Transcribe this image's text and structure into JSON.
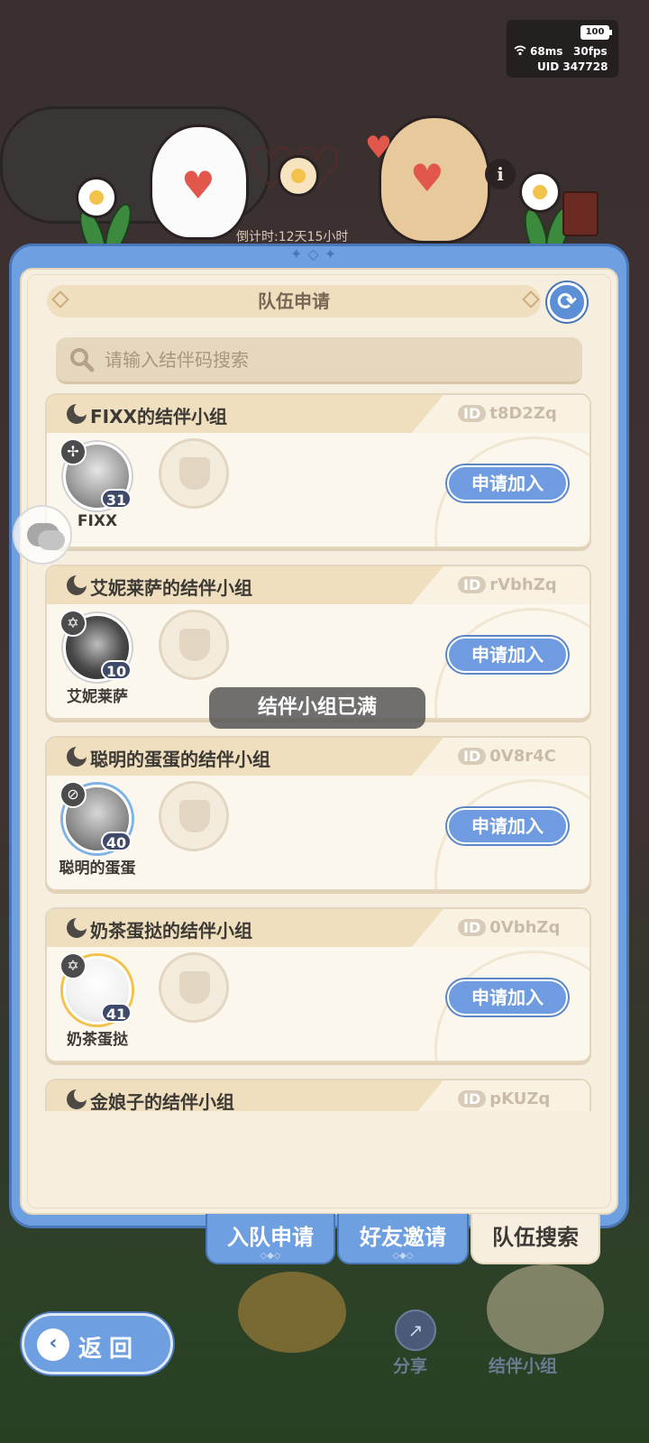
{
  "status": {
    "battery": "100",
    "ping": "68ms",
    "fps": "30fps",
    "uid": "UID 347728"
  },
  "header": {
    "countdown": "倒计时:12天15小时",
    "info_icon": "i"
  },
  "panel": {
    "title": "队伍申请",
    "refresh_icon": "⟳",
    "search_placeholder": "请输入结伴码搜索"
  },
  "groups": [
    {
      "title": "FIXX的结伴小组",
      "id_label": "ID",
      "id": "t8D2Zq",
      "member": "FIXX",
      "level": "31",
      "element": "✢",
      "join": "申请加入"
    },
    {
      "title": "艾妮莱萨的结伴小组",
      "id_label": "ID",
      "id": "rVbhZq",
      "member": "艾妮莱萨",
      "level": "10",
      "element": "✡",
      "join": "申请加入"
    },
    {
      "title": "聪明的蛋蛋的结伴小组",
      "id_label": "ID",
      "id": "0V8r4C",
      "member": "聪明的蛋蛋",
      "level": "40",
      "element": "⊘",
      "join": "申请加入"
    },
    {
      "title": "奶茶蛋挞的结伴小组",
      "id_label": "ID",
      "id": "0VbhZq",
      "member": "奶茶蛋挞",
      "level": "41",
      "element": "✡",
      "join": "申请加入"
    },
    {
      "title": "金娘子的结伴小组",
      "id_label": "ID",
      "id": "pKUZq"
    }
  ],
  "toast": "结伴小组已满",
  "tabs": [
    {
      "label": "入队申请",
      "active": false
    },
    {
      "label": "好友邀请",
      "active": false
    },
    {
      "label": "队伍搜索",
      "active": true
    }
  ],
  "bottom": {
    "back_label": "返回",
    "share_label": "分享",
    "partner_label": "结伴小组"
  },
  "colors": {
    "panel_blue": "#6e9fe0",
    "panel_cream": "#f6efe0",
    "join_button": "#6f9ce0"
  }
}
